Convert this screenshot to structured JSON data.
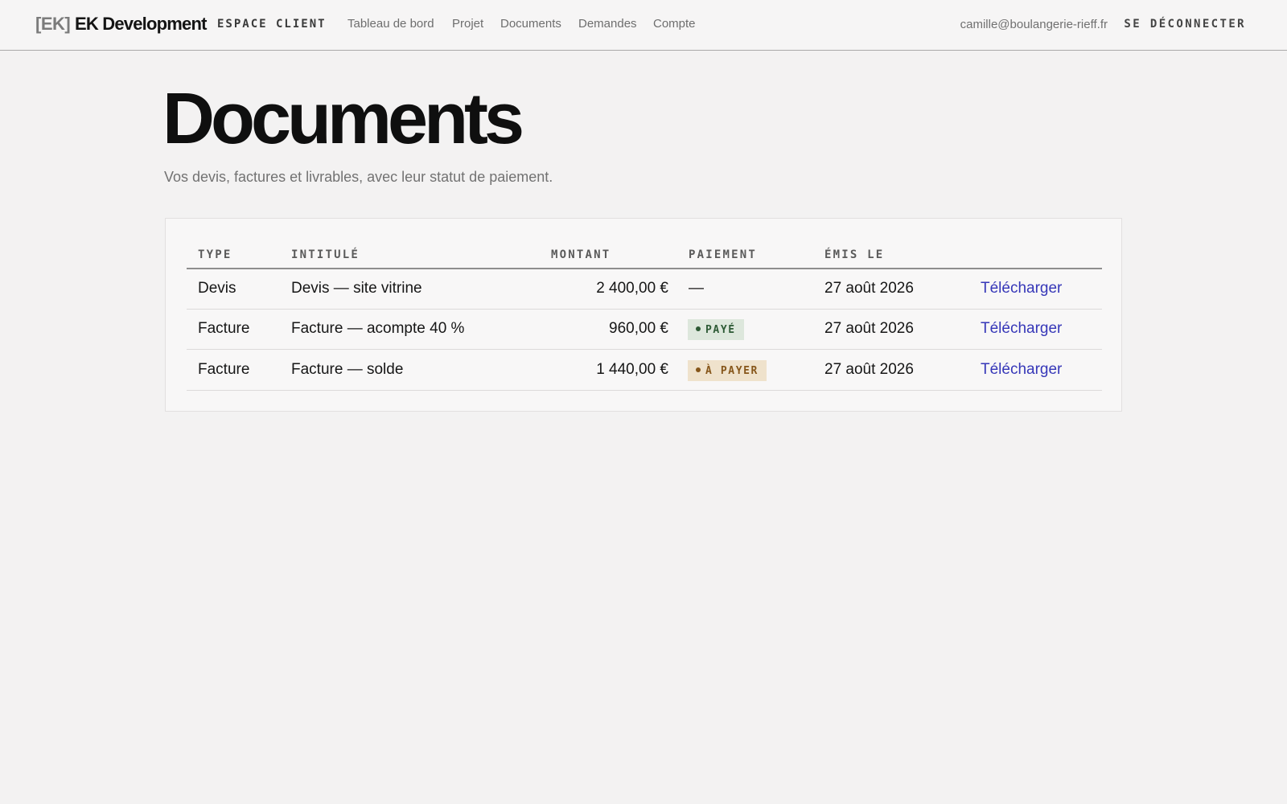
{
  "header": {
    "brand_mark": "[EK]",
    "brand_name": "EK Development",
    "brand_sub": "ESPACE CLIENT",
    "nav": [
      "Tableau de bord",
      "Projet",
      "Documents",
      "Demandes",
      "Compte"
    ],
    "user_email": "camille@boulangerie-rieff.fr",
    "logout_label": "SE DÉCONNECTER"
  },
  "page": {
    "title": "Documents",
    "subtitle": "Vos devis, factures et livrables, avec leur statut de paiement."
  },
  "table": {
    "headers": [
      "TYPE",
      "INTITULÉ",
      "MONTANT",
      "PAIEMENT",
      "ÉMIS LE"
    ],
    "rows": [
      {
        "type": "Devis",
        "title": "Devis — site vitrine",
        "amount": "2 400,00 €",
        "payment": "—",
        "issued": "27 août 2026",
        "action": "Télécharger"
      },
      {
        "type": "Facture",
        "title": "Facture — acompte 40 %",
        "amount": "960,00 €",
        "payment": "PAYÉ",
        "issued": "27 août 2026",
        "action": "Télécharger"
      },
      {
        "type": "Facture",
        "title": "Facture — solde",
        "amount": "1 440,00 €",
        "payment": "À PAYER",
        "issued": "27 août 2026",
        "action": "Télécharger"
      }
    ]
  },
  "colors": {
    "accent_link": "#3637b8",
    "paid_badge_bg": "#dde7dc",
    "paid_badge_text": "#2d5a35",
    "due_badge_bg": "#efe2cc",
    "due_badge_text": "#86561a"
  },
  "icons": {
    "status_dot": "dot-icon"
  }
}
